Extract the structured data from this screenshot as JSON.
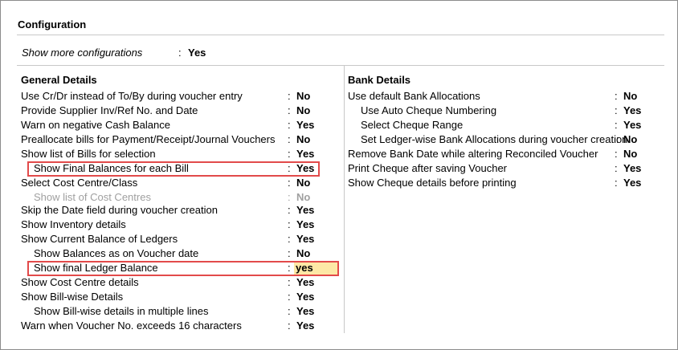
{
  "title": "Configuration",
  "more_config": {
    "label": "Show more configurations",
    "colon": ":",
    "value": "Yes"
  },
  "general": {
    "title": "General Details",
    "rows": [
      {
        "label": "Use Cr/Dr instead of To/By during voucher entry",
        "value": "No"
      },
      {
        "label": "Provide Supplier Inv/Ref No. and Date",
        "value": "No"
      },
      {
        "label": "Warn on negative Cash Balance",
        "value": "Yes"
      },
      {
        "label": "Preallocate bills for Payment/Receipt/Journal Vouchers",
        "value": "No"
      },
      {
        "label": "Show list of Bills for selection",
        "value": "Yes"
      },
      {
        "label": "Show Final Balances for each Bill",
        "value": "Yes"
      },
      {
        "label": "Select Cost Centre/Class",
        "value": "No"
      },
      {
        "label": "Show list of Cost Centres",
        "value": "No"
      },
      {
        "label": "Skip the Date field during voucher creation",
        "value": "Yes"
      },
      {
        "label": "Show Inventory details",
        "value": "Yes"
      },
      {
        "label": "Show Current Balance of Ledgers",
        "value": "Yes"
      },
      {
        "label": "Show Balances as on Voucher date",
        "value": "No"
      },
      {
        "label": "Show final Ledger Balance",
        "value": "yes"
      },
      {
        "label": "Show Cost Centre details",
        "value": "Yes"
      },
      {
        "label": "Show Bill-wise Details",
        "value": "Yes"
      },
      {
        "label": "Show Bill-wise details in multiple lines",
        "value": "Yes"
      },
      {
        "label": "Warn when Voucher No. exceeds 16 characters",
        "value": "Yes"
      }
    ]
  },
  "bank": {
    "title": "Bank Details",
    "rows": [
      {
        "label": "Use default Bank Allocations",
        "value": "No"
      },
      {
        "label": "Use Auto Cheque Numbering",
        "value": "Yes"
      },
      {
        "label": "Select Cheque Range",
        "value": "Yes"
      },
      {
        "label": "Set Ledger-wise Bank Allocations during voucher creation",
        "value": "No"
      },
      {
        "label": "Remove Bank Date while altering Reconciled Voucher",
        "value": "No"
      },
      {
        "label": "Print Cheque after saving Voucher",
        "value": "Yes"
      },
      {
        "label": "Show Cheque details before printing",
        "value": "Yes"
      }
    ]
  },
  "colon": ":",
  "colors": {
    "highlight_border": "#e24a4a",
    "edit_bg": "#fde8a6",
    "disabled_text": "#a0a0a0"
  }
}
